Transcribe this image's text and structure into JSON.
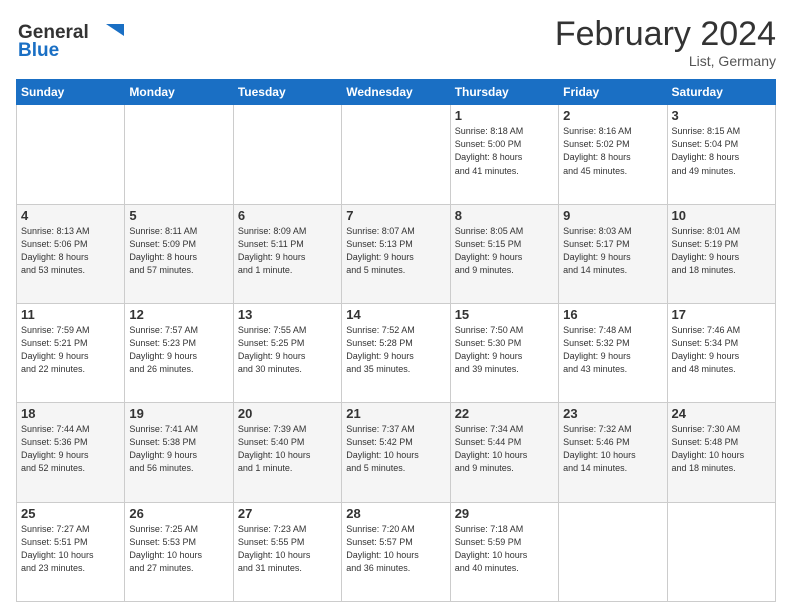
{
  "logo": {
    "line1": "General",
    "line2": "Blue"
  },
  "title": "February 2024",
  "location": "List, Germany",
  "days_of_week": [
    "Sunday",
    "Monday",
    "Tuesday",
    "Wednesday",
    "Thursday",
    "Friday",
    "Saturday"
  ],
  "weeks": [
    [
      {
        "num": "",
        "detail": ""
      },
      {
        "num": "",
        "detail": ""
      },
      {
        "num": "",
        "detail": ""
      },
      {
        "num": "",
        "detail": ""
      },
      {
        "num": "1",
        "detail": "Sunrise: 8:18 AM\nSunset: 5:00 PM\nDaylight: 8 hours\nand 41 minutes."
      },
      {
        "num": "2",
        "detail": "Sunrise: 8:16 AM\nSunset: 5:02 PM\nDaylight: 8 hours\nand 45 minutes."
      },
      {
        "num": "3",
        "detail": "Sunrise: 8:15 AM\nSunset: 5:04 PM\nDaylight: 8 hours\nand 49 minutes."
      }
    ],
    [
      {
        "num": "4",
        "detail": "Sunrise: 8:13 AM\nSunset: 5:06 PM\nDaylight: 8 hours\nand 53 minutes."
      },
      {
        "num": "5",
        "detail": "Sunrise: 8:11 AM\nSunset: 5:09 PM\nDaylight: 8 hours\nand 57 minutes."
      },
      {
        "num": "6",
        "detail": "Sunrise: 8:09 AM\nSunset: 5:11 PM\nDaylight: 9 hours\nand 1 minute."
      },
      {
        "num": "7",
        "detail": "Sunrise: 8:07 AM\nSunset: 5:13 PM\nDaylight: 9 hours\nand 5 minutes."
      },
      {
        "num": "8",
        "detail": "Sunrise: 8:05 AM\nSunset: 5:15 PM\nDaylight: 9 hours\nand 9 minutes."
      },
      {
        "num": "9",
        "detail": "Sunrise: 8:03 AM\nSunset: 5:17 PM\nDaylight: 9 hours\nand 14 minutes."
      },
      {
        "num": "10",
        "detail": "Sunrise: 8:01 AM\nSunset: 5:19 PM\nDaylight: 9 hours\nand 18 minutes."
      }
    ],
    [
      {
        "num": "11",
        "detail": "Sunrise: 7:59 AM\nSunset: 5:21 PM\nDaylight: 9 hours\nand 22 minutes."
      },
      {
        "num": "12",
        "detail": "Sunrise: 7:57 AM\nSunset: 5:23 PM\nDaylight: 9 hours\nand 26 minutes."
      },
      {
        "num": "13",
        "detail": "Sunrise: 7:55 AM\nSunset: 5:25 PM\nDaylight: 9 hours\nand 30 minutes."
      },
      {
        "num": "14",
        "detail": "Sunrise: 7:52 AM\nSunset: 5:28 PM\nDaylight: 9 hours\nand 35 minutes."
      },
      {
        "num": "15",
        "detail": "Sunrise: 7:50 AM\nSunset: 5:30 PM\nDaylight: 9 hours\nand 39 minutes."
      },
      {
        "num": "16",
        "detail": "Sunrise: 7:48 AM\nSunset: 5:32 PM\nDaylight: 9 hours\nand 43 minutes."
      },
      {
        "num": "17",
        "detail": "Sunrise: 7:46 AM\nSunset: 5:34 PM\nDaylight: 9 hours\nand 48 minutes."
      }
    ],
    [
      {
        "num": "18",
        "detail": "Sunrise: 7:44 AM\nSunset: 5:36 PM\nDaylight: 9 hours\nand 52 minutes."
      },
      {
        "num": "19",
        "detail": "Sunrise: 7:41 AM\nSunset: 5:38 PM\nDaylight: 9 hours\nand 56 minutes."
      },
      {
        "num": "20",
        "detail": "Sunrise: 7:39 AM\nSunset: 5:40 PM\nDaylight: 10 hours\nand 1 minute."
      },
      {
        "num": "21",
        "detail": "Sunrise: 7:37 AM\nSunset: 5:42 PM\nDaylight: 10 hours\nand 5 minutes."
      },
      {
        "num": "22",
        "detail": "Sunrise: 7:34 AM\nSunset: 5:44 PM\nDaylight: 10 hours\nand 9 minutes."
      },
      {
        "num": "23",
        "detail": "Sunrise: 7:32 AM\nSunset: 5:46 PM\nDaylight: 10 hours\nand 14 minutes."
      },
      {
        "num": "24",
        "detail": "Sunrise: 7:30 AM\nSunset: 5:48 PM\nDaylight: 10 hours\nand 18 minutes."
      }
    ],
    [
      {
        "num": "25",
        "detail": "Sunrise: 7:27 AM\nSunset: 5:51 PM\nDaylight: 10 hours\nand 23 minutes."
      },
      {
        "num": "26",
        "detail": "Sunrise: 7:25 AM\nSunset: 5:53 PM\nDaylight: 10 hours\nand 27 minutes."
      },
      {
        "num": "27",
        "detail": "Sunrise: 7:23 AM\nSunset: 5:55 PM\nDaylight: 10 hours\nand 31 minutes."
      },
      {
        "num": "28",
        "detail": "Sunrise: 7:20 AM\nSunset: 5:57 PM\nDaylight: 10 hours\nand 36 minutes."
      },
      {
        "num": "29",
        "detail": "Sunrise: 7:18 AM\nSunset: 5:59 PM\nDaylight: 10 hours\nand 40 minutes."
      },
      {
        "num": "",
        "detail": ""
      },
      {
        "num": "",
        "detail": ""
      }
    ]
  ]
}
